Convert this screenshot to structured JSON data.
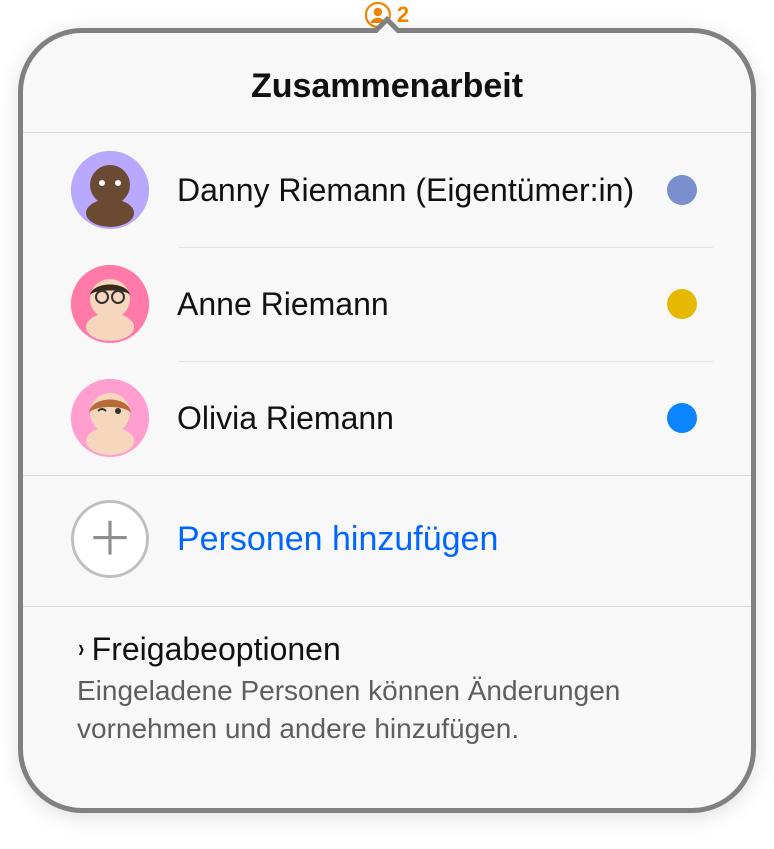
{
  "indicator": {
    "count": "2"
  },
  "title": "Zusammenarbeit",
  "participants": [
    {
      "name": "Danny Riemann (Eigentümer:in)",
      "dot": "#7b8fcf",
      "avatar_bg": "#b9a8ff",
      "icon": "memoji-1"
    },
    {
      "name": "Anne Riemann",
      "dot": "#e6b800",
      "avatar_bg": "#ff7aa8",
      "icon": "memoji-2"
    },
    {
      "name": "Olivia Riemann",
      "dot": "#0a84ff",
      "avatar_bg": "#ff9ecf",
      "icon": "memoji-3"
    }
  ],
  "add_label": "Personen hinzufügen",
  "options": {
    "title": "Freigabeoptionen",
    "description": "Eingeladene Personen können Änderungen vornehmen und andere hinzufügen."
  },
  "accent_orange": "#f28500",
  "link_color": "#0066ff"
}
